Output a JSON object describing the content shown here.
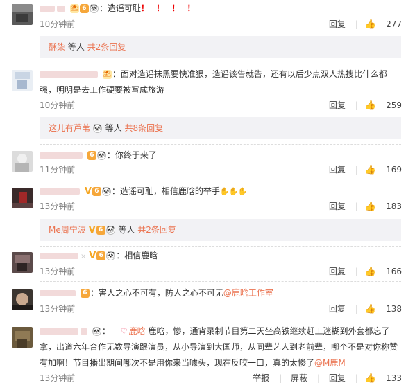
{
  "comments": [
    {
      "text": "造谣可耻",
      "marks": "！ ！ ！ ！",
      "time": "10分钟前",
      "reply": "回复",
      "likes": "277",
      "sub": {
        "name": "酥柒",
        "mid": "等人",
        "count": "共2条回复"
      }
    },
    {
      "text": "面对造谣抹黑要快准狠，造谣该告就告，还有以后少点双人热搜比什么都",
      "text2": "强，明明是去工作硬要被写成旅游",
      "time": "10分钟前",
      "reply": "回复",
      "likes": "259",
      "sub": {
        "name": "这儿有芦苇",
        "mid": "等人",
        "count": "共8条回复"
      }
    },
    {
      "text": "你终于来了",
      "time": "11分钟前",
      "reply": "回复",
      "likes": "169"
    },
    {
      "text": "造谣可耻，相信鹿晗的举手",
      "time": "13分钟前",
      "reply": "回复",
      "likes": "183",
      "sub": {
        "name": "Me周宁波",
        "mid": "等人",
        "count": "共2条回复"
      }
    },
    {
      "text": "相信鹿晗",
      "time": "13分钟前",
      "reply": "回复",
      "likes": "166"
    },
    {
      "text": "害人之心不可有，防人之心不可无",
      "mention": "@鹿晗工作室",
      "time": "13分钟前",
      "reply": "回复",
      "likes": "138"
    },
    {
      "tag": "鹿晗",
      "text": "鹿晗，惨，通宵录制节目第二天坐高铁继续赶工迷糊到外套都忘了",
      "text2": "拿，出道六年合作无数导演跟演员，从小导演到大国师，从同辈艺人到老前辈，哪个不是对你称赞",
      "text3": "有加啊！节目播出期间哪次不是用你来当噱头，现在反咬一口，真的太惨了",
      "mention": "@M鹿M",
      "time": "13分钟前",
      "report": "举报",
      "block": "屏蔽",
      "reply": "回复",
      "likes": "133"
    }
  ],
  "colors": {
    "link": "#eb7350",
    "reply_bg": "#f2f2f5",
    "time": "#808080"
  }
}
